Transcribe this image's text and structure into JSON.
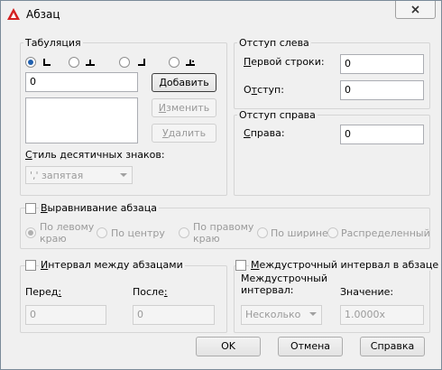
{
  "window": {
    "title": "Абзац"
  },
  "tabs": {
    "title": "Табуляция",
    "selected_type": "left",
    "position_value": "0",
    "add_label_pre": "",
    "add_label_u": "Д",
    "add_label_post": "обавить",
    "change_label_pre": "",
    "change_label_u": "И",
    "change_label_post": "зменить",
    "delete_label_pre": "",
    "delete_label_u": "У",
    "delete_label_post": "далить",
    "decimal_style_label_pre": "",
    "decimal_style_label_u": "С",
    "decimal_style_label_post": "тиль десятичных знаков:",
    "decimal_style_value": "',' запятая"
  },
  "indent_left": {
    "title": "Отступ слева",
    "first_line_label_pre": "",
    "first_line_label_u": "П",
    "first_line_label_post": "ервой строки:",
    "first_line_value": "0",
    "indent_label_pre": "О",
    "indent_label_u": "т",
    "indent_label_post": "ступ:",
    "indent_value": "0"
  },
  "indent_right": {
    "title": "Отступ справа",
    "right_label_pre": "",
    "right_label_u": "С",
    "right_label_post": "права:",
    "right_value": "0"
  },
  "alignment": {
    "checkbox_label_pre": "",
    "checkbox_label_u": "В",
    "checkbox_label_post": "ыравнивание абзаца",
    "options": [
      {
        "line1": "По левому",
        "line2": "краю"
      },
      {
        "line1": "По центру",
        "line2": ""
      },
      {
        "line1": "По правому",
        "line2": "краю"
      },
      {
        "line1": "По ширине",
        "line2": ""
      },
      {
        "line1": "Распределенный",
        "line2": ""
      }
    ]
  },
  "spacing": {
    "checkbox_label_pre": "",
    "checkbox_label_u": "И",
    "checkbox_label_post": "нтервал между абзацами",
    "before_label_pre": "Перед",
    "before_label_u": ":",
    "before_value": "0",
    "after_label_pre": "После",
    "after_label_u": ":",
    "after_value": "0"
  },
  "line_spacing": {
    "checkbox_label_pre": "",
    "checkbox_label_u": "М",
    "checkbox_label_post": "еждустрочный интервал в абзаце",
    "interval_label_line1": "Междустрочный",
    "interval_label_line2": "интервал:",
    "interval_value": "Несколько",
    "value_label": "Значение:",
    "value_value": "1.0000x"
  },
  "buttons": {
    "ok": "OK",
    "cancel": "Отмена",
    "help": "Справка"
  }
}
